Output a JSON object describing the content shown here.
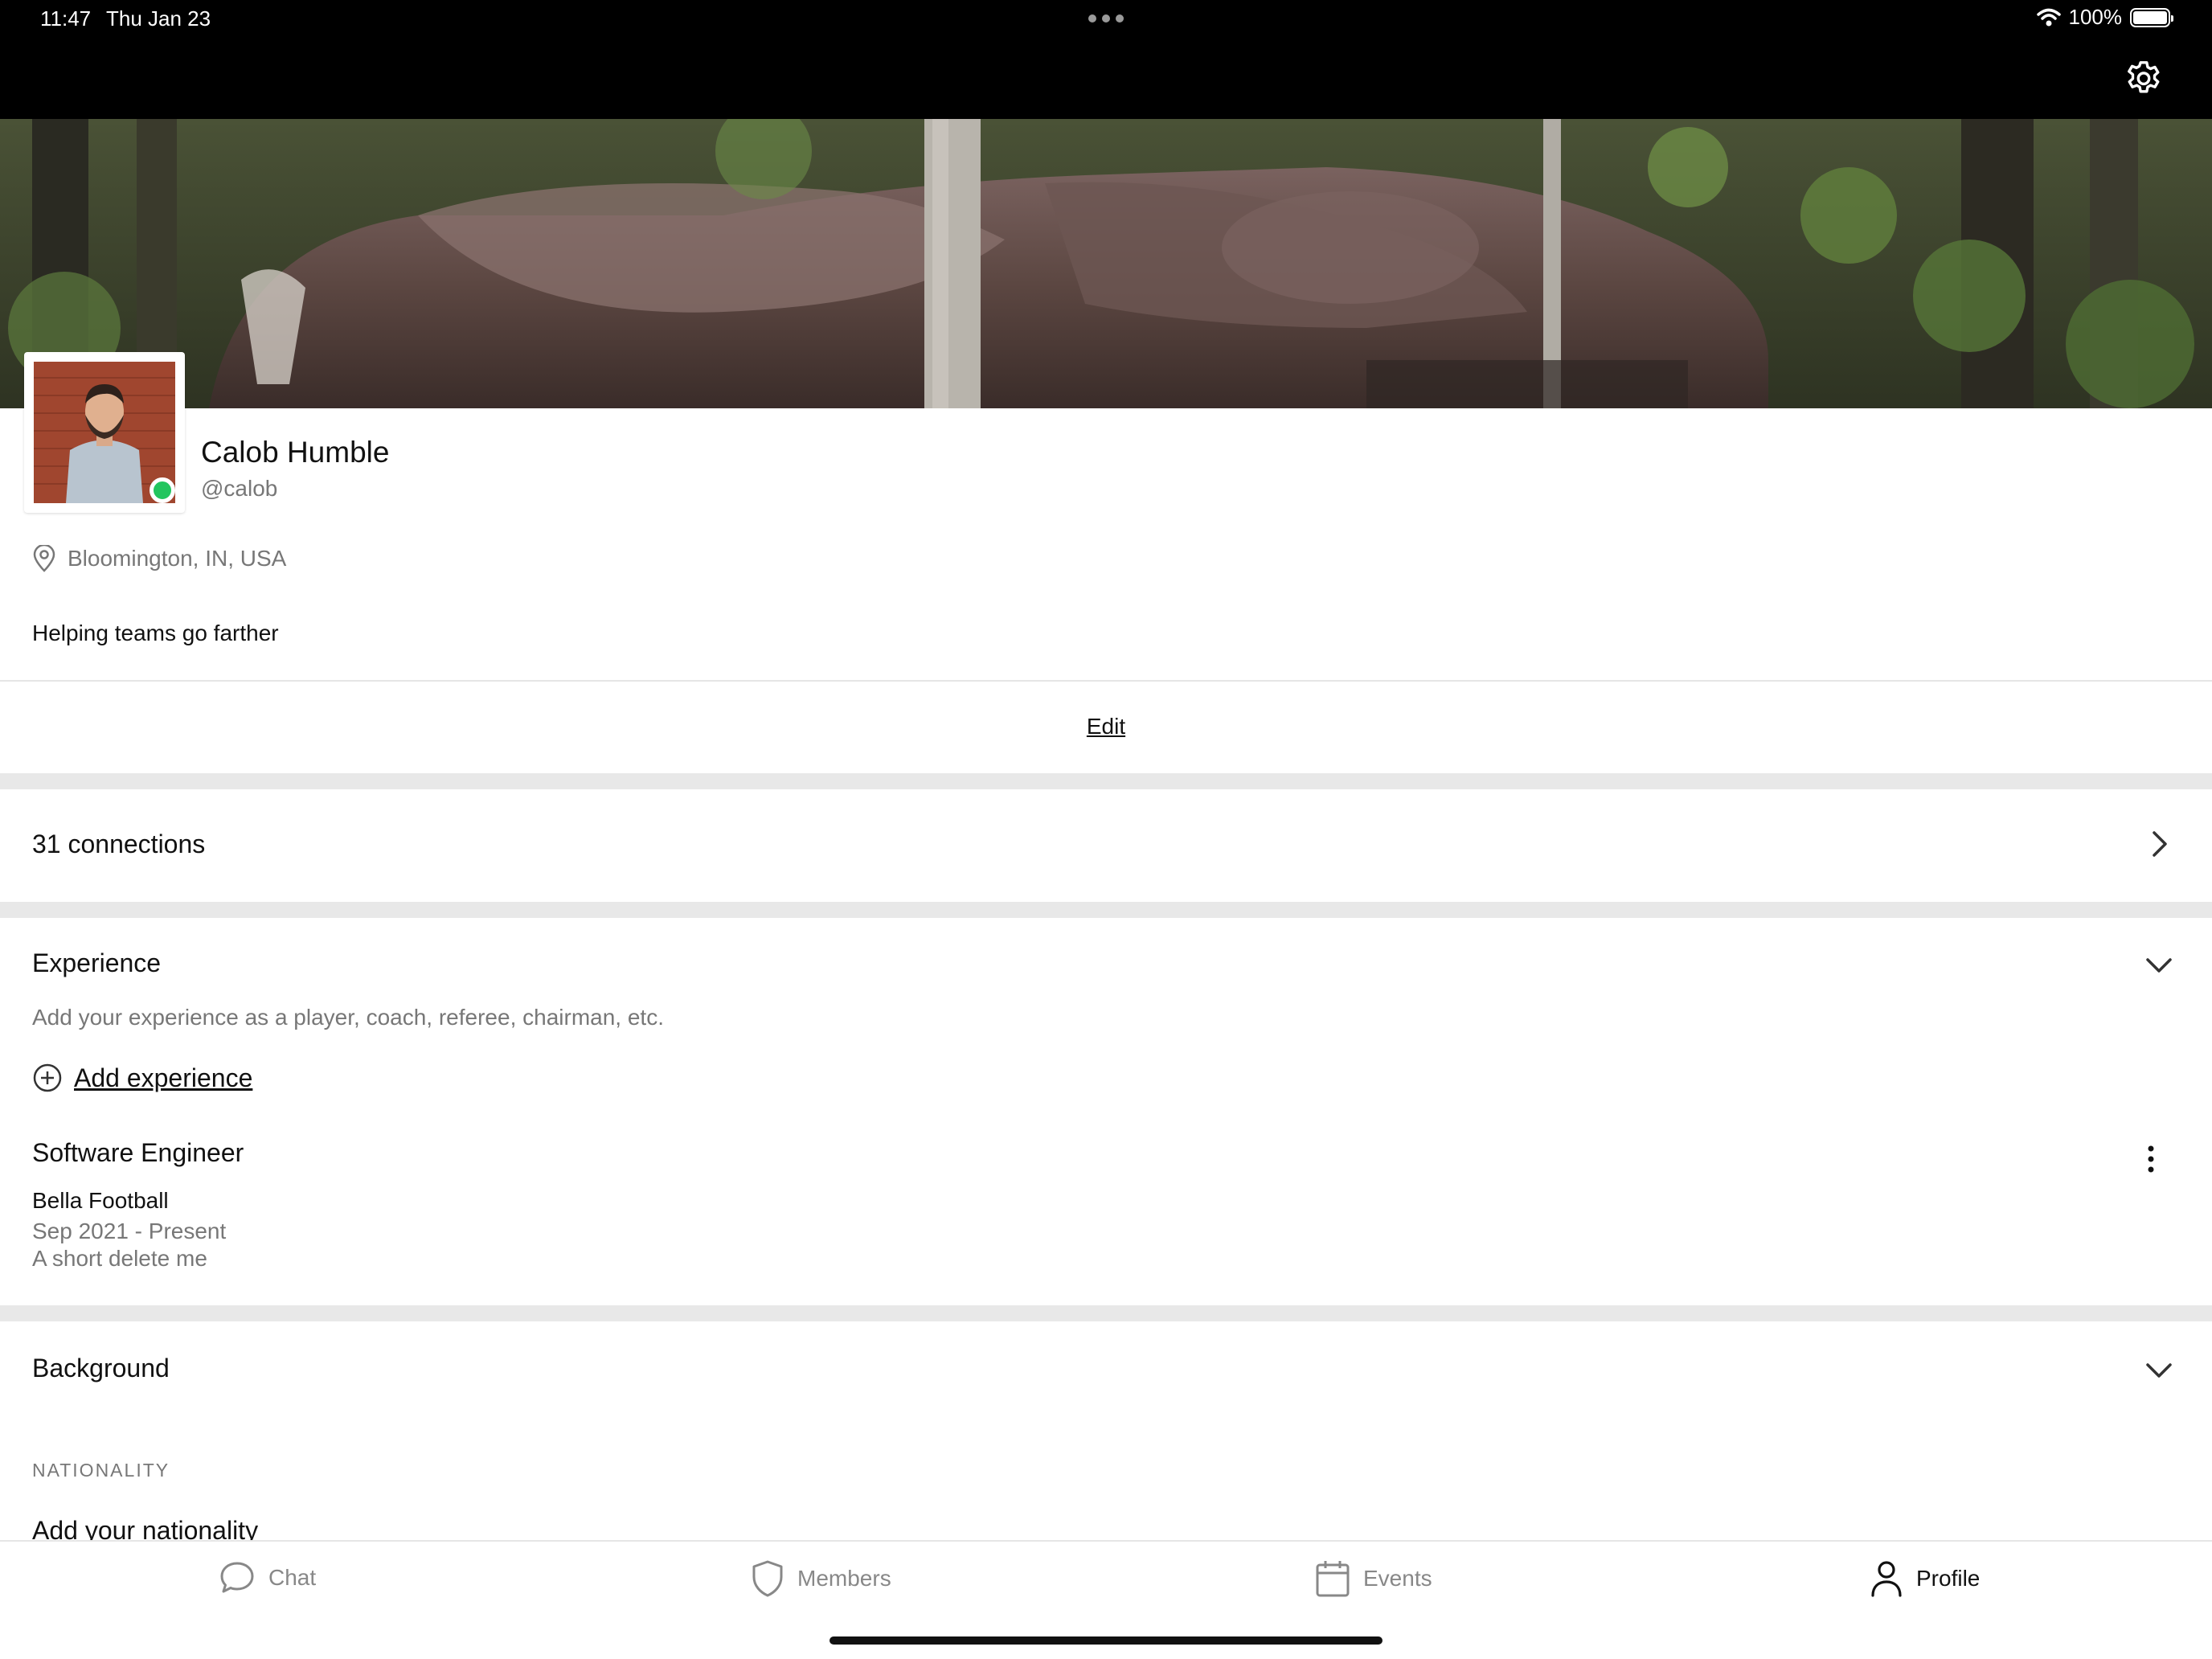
{
  "status_bar": {
    "time": "11:47",
    "date": "Thu Jan 23",
    "battery": "100%"
  },
  "header": {
    "settings_icon": "gear-icon"
  },
  "profile": {
    "name": "Calob Humble",
    "handle": "@calob",
    "online": true,
    "status_color": "#22c55e",
    "location": "Bloomington, IN, USA",
    "tagline": "Helping teams go farther",
    "edit_label": "Edit"
  },
  "connections": {
    "label": "31 connections"
  },
  "experience": {
    "title": "Experience",
    "hint": "Add your experience as a player, coach, referee, chairman, etc.",
    "add_label": "Add experience",
    "items": [
      {
        "title": "Software Engineer",
        "organization": "Bella Football",
        "dates": "Sep 2021 - Present",
        "description": "A short delete me"
      }
    ]
  },
  "background": {
    "title": "Background",
    "nationality_label": "NATIONALITY",
    "nationality_value": "Add your nationality"
  },
  "tabbar": {
    "tabs": [
      {
        "label": "Chat",
        "icon": "chat-bubble-icon",
        "active": false
      },
      {
        "label": "Members",
        "icon": "shield-icon",
        "active": false
      },
      {
        "label": "Events",
        "icon": "calendar-icon",
        "active": false
      },
      {
        "label": "Profile",
        "icon": "person-icon",
        "active": true
      }
    ]
  }
}
